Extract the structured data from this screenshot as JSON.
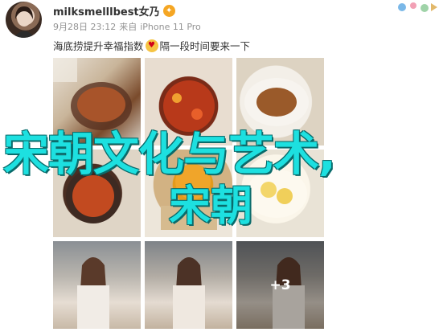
{
  "post": {
    "username": "milksmelllbest女乃",
    "badge": "✦",
    "date": "9月28日 23:12",
    "source_prefix": "来自",
    "device": "iPhone 11 Pro",
    "text_before_emoji": "海底捞提升幸福指数",
    "emoji": "♥",
    "text_after_emoji": "隔一段时间要来一下",
    "more_photos": "+3"
  },
  "watermark": {
    "line1": "宋朝文化与艺术,",
    "line2": "宋朝"
  },
  "colors": {
    "watermark": "#1de0e0",
    "meta_gray": "#939393",
    "badge": "#f5a623"
  }
}
